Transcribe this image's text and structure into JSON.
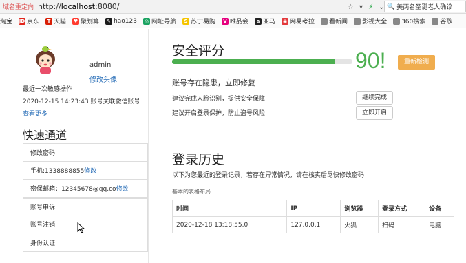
{
  "browser": {
    "redirect_label": "域名重定向",
    "url_scheme": "http://",
    "url_host": "localhost",
    "url_port": ":8080/",
    "search_text": "美两名圣诞老人确诊",
    "bookmarks": [
      {
        "label": "淘宝",
        "icon": "taobao-icon",
        "color": "#ff5000",
        "glyph": ""
      },
      {
        "label": "京东",
        "icon": "jd-icon",
        "color": "#e1251b",
        "glyph": "JD"
      },
      {
        "label": "天猫",
        "icon": "tmall-icon",
        "color": "#d81e06",
        "glyph": "T"
      },
      {
        "label": "聚划算",
        "icon": "juhuasuan-icon",
        "color": "#ff3b2f",
        "glyph": "♥"
      },
      {
        "label": "hao123",
        "icon": "hao123-icon",
        "color": "#1a1a1a",
        "glyph": "✎"
      },
      {
        "label": "网址导航",
        "icon": "wangzhi-icon",
        "color": "#1aa260",
        "glyph": "◎"
      },
      {
        "label": "苏宁易购",
        "icon": "suning-icon",
        "color": "#f5c400",
        "glyph": "S"
      },
      {
        "label": "唯品会",
        "icon": "vip-icon",
        "color": "#e6007e",
        "glyph": "V"
      },
      {
        "label": "亚马",
        "icon": "amazon-icon",
        "color": "#222",
        "glyph": "a"
      },
      {
        "label": "网易考拉",
        "icon": "kaola-icon",
        "color": "#e3393c",
        "glyph": "◉"
      },
      {
        "label": "看新闻",
        "icon": "news-icon",
        "color": "#888",
        "glyph": ""
      },
      {
        "label": "影视大全",
        "icon": "video-icon",
        "color": "#888",
        "glyph": ""
      },
      {
        "label": "360搜索",
        "icon": "so360-icon",
        "color": "#888",
        "glyph": ""
      },
      {
        "label": "谷歌",
        "icon": "google-icon",
        "color": "#888",
        "glyph": ""
      }
    ]
  },
  "profile": {
    "username": "admin",
    "edit_avatar": "修改头像",
    "last_op_title": "最近一次敏感操作",
    "last_op": "2020-12-15 14:23:43 账号关联微信账号",
    "see_more": "查看更多"
  },
  "quick": {
    "title": "快速通道",
    "items": [
      {
        "text": "修改密码",
        "link": ""
      },
      {
        "text": "手机:1338888855 ",
        "link": "修改"
      },
      {
        "text": "密保邮箱：12345678@qq.co",
        "link": "修改"
      },
      {
        "text": "账号申诉",
        "link": ""
      },
      {
        "text": "账号注销",
        "link": ""
      },
      {
        "text": "身份认证",
        "link": ""
      }
    ]
  },
  "security": {
    "title": "安全评分",
    "score": "90!",
    "score_value": 90,
    "score_max": 100,
    "recheck_label": "重新检测",
    "risk_title": "账号存在隐患，立即修复",
    "tip1": "建议完成人脸识别，提供安全保障",
    "tip1_button": "继续完成",
    "tip2": "建议开启登录保护，防止盗号风险",
    "tip2_button": "立即开启",
    "accent": "#4caf50",
    "button_color": "#f0ad4e"
  },
  "login_history": {
    "title": "登录历史",
    "desc": "以下为您最近的登录记录，若存在异常情况，请在核实后尽快修改密码",
    "caption": "基本的表格布局",
    "columns": [
      "时间",
      "IP",
      "浏览器",
      "登录方式",
      "设备"
    ],
    "rows": [
      [
        "2020-12-18 13:18:55.0",
        "127.0.0.1",
        "火狐",
        "扫码",
        "电脑"
      ]
    ]
  }
}
